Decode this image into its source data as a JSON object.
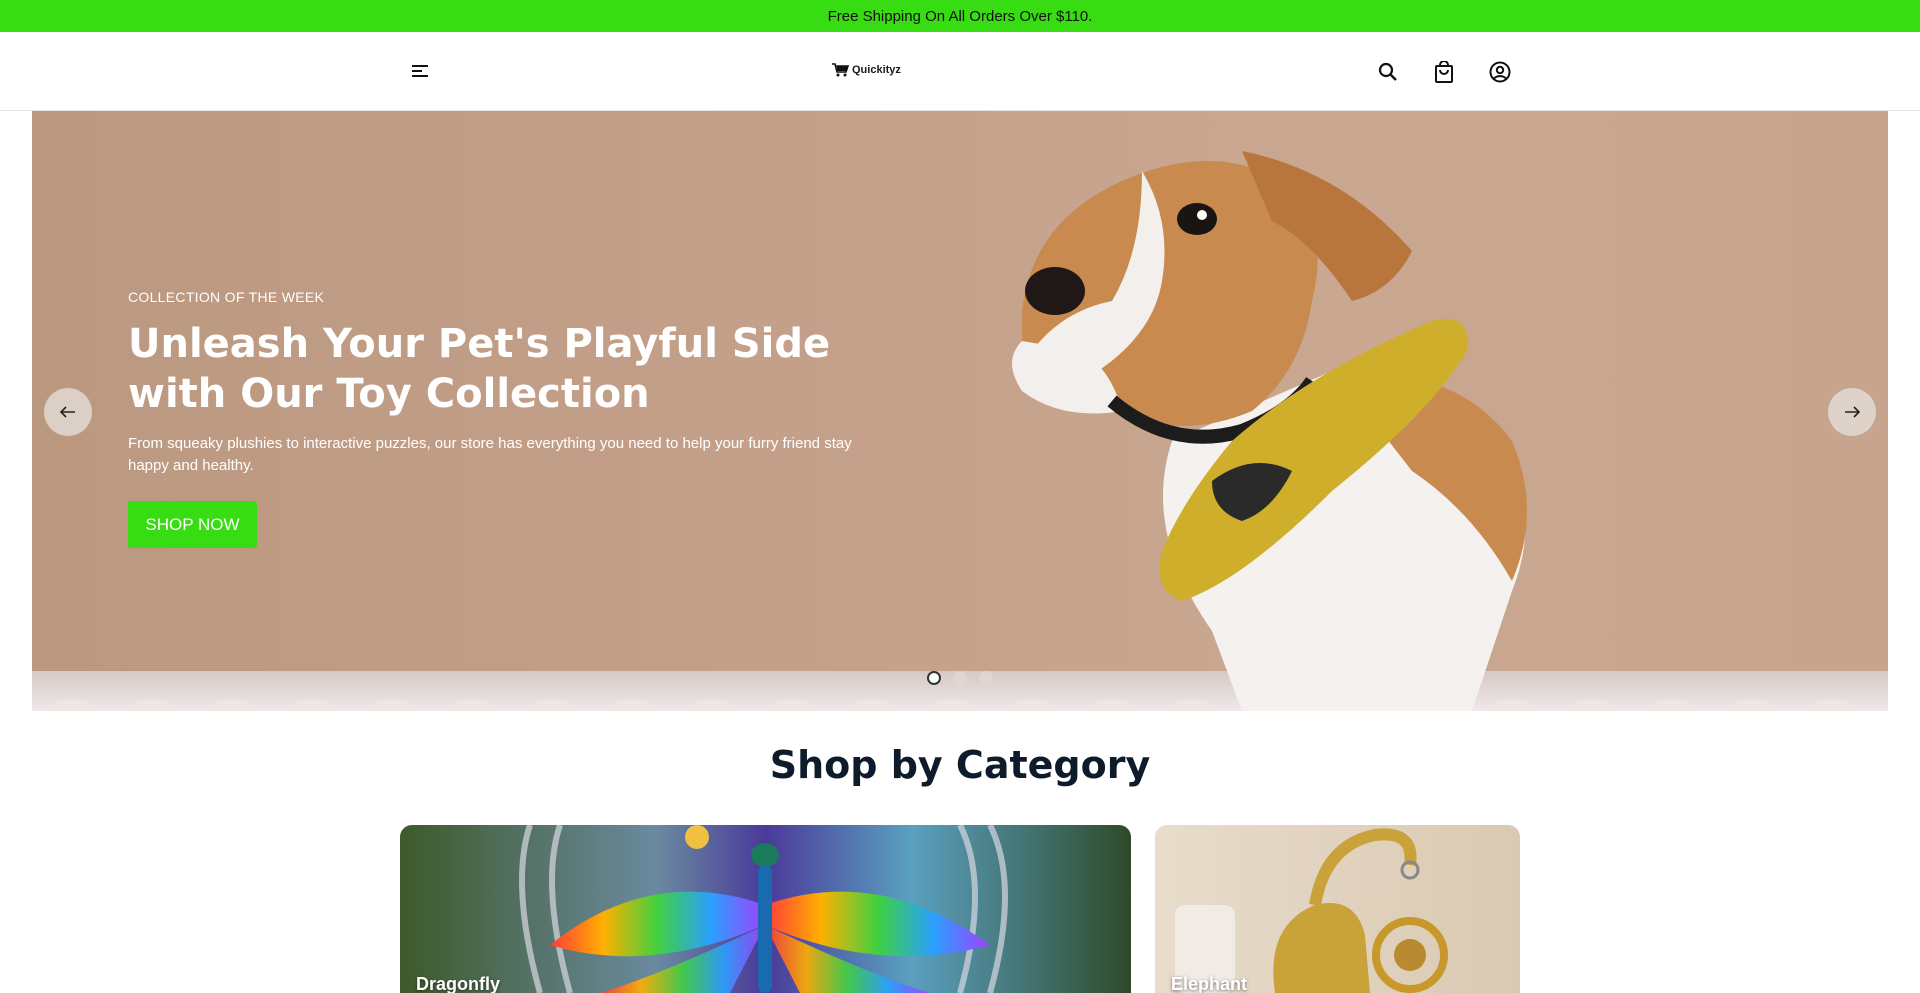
{
  "announcement": {
    "text": "Free Shipping On All Orders Over $110."
  },
  "header": {
    "logo_text": "Quickityz",
    "icons": [
      "menu-icon",
      "search-icon",
      "bag-icon",
      "account-icon"
    ]
  },
  "hero": {
    "eyebrow": "COLLECTION OF THE WEEK",
    "title": "Unleash Your Pet's Playful Side with Our Toy Collection",
    "description": "From squeaky plushies to interactive puzzles, our store has everything you need to help your furry friend stay happy and healthy.",
    "cta_label": "SHOP NOW",
    "slides_count": 3,
    "active_slide": 1
  },
  "categories": {
    "title": "Shop by Category",
    "items": [
      {
        "label": "Dragonfly"
      },
      {
        "label": "Elephant"
      }
    ]
  },
  "colors": {
    "accent": "#37dc12",
    "heading": "#0d1b2a"
  }
}
